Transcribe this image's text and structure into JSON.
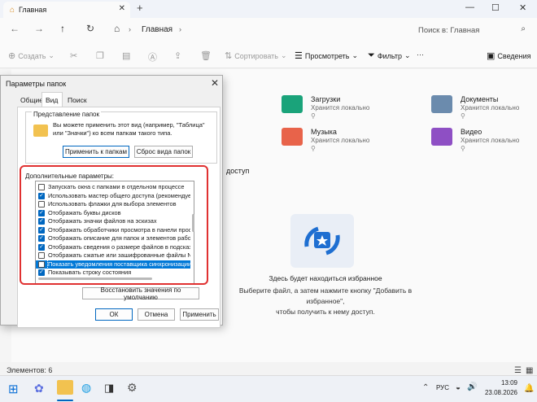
{
  "window": {
    "tab_title": "Главная",
    "new_tab": "+",
    "minimize": "—",
    "maximize": "☐",
    "close": "✕"
  },
  "nav": {
    "back": "←",
    "forward": "→",
    "up": "↑",
    "breadcrumb": "Главная",
    "search_placeholder": "Поиск в: Главная"
  },
  "toolbar": {
    "create": "Создать",
    "sort": "Сортировать",
    "view": "Просмотреть",
    "filter": "Фильтр",
    "details": "Сведения"
  },
  "quick_access": [
    {
      "name": "Загрузки",
      "sub": "Хранится локально",
      "color": "#1aa37a"
    },
    {
      "name": "Документы",
      "sub": "Хранится локально",
      "color": "#6b8bad"
    },
    {
      "name": "Музыка",
      "sub": "Хранится локально",
      "color": "#e8634a"
    },
    {
      "name": "Видео",
      "sub": "Хранится локально",
      "color": "#8e4fc4"
    }
  ],
  "partial_text": "доступ",
  "favorites": {
    "title": "Здесь будет находиться избранное",
    "desc1": "Выберите файл, а затем нажмите кнопку \"Добавить в избранное\",",
    "desc2": "чтобы получить к нему доступ."
  },
  "status": "Элементов: 6",
  "taskbar": {
    "lang": "РУС",
    "time": "13:09",
    "date": "23.08.2026"
  },
  "dialog": {
    "title": "Параметры папок",
    "tabs": [
      "Общие",
      "Вид",
      "Поиск"
    ],
    "group_title": "Представление папок",
    "group_text": "Вы можете применить этот вид (например, \"Таблица\" или \"Значки\") ко всем папкам такого типа.",
    "apply_to_folders": "Применить к папкам",
    "reset_folders": "Сброс вида папок",
    "advanced_label": "Дополнительные параметры:",
    "options": [
      {
        "label": "Запускать окна с папками в отдельном процессе",
        "checked": false,
        "selected": false
      },
      {
        "label": "Использовать мастер общего доступа (рекомендует",
        "checked": true,
        "selected": false
      },
      {
        "label": "Использовать флажки для выбора элементов",
        "checked": false,
        "selected": false
      },
      {
        "label": "Отображать буквы дисков",
        "checked": true,
        "selected": false
      },
      {
        "label": "Отображать значки файлов на эскизах",
        "checked": true,
        "selected": false
      },
      {
        "label": "Отображать обработчики просмотра в панели просм",
        "checked": true,
        "selected": false
      },
      {
        "label": "Отображать описание для папок и элементов рабоч",
        "checked": true,
        "selected": false
      },
      {
        "label": "Отображать сведения о размере файлов в подсказк",
        "checked": true,
        "selected": false
      },
      {
        "label": "Отображать сжатые или зашифрованные файлы NTI",
        "checked": false,
        "selected": false
      },
      {
        "label": "Показать уведомления поставщика синхронизации",
        "checked": false,
        "selected": true
      },
      {
        "label": "Показывать строку состояния",
        "checked": true,
        "selected": false
      }
    ],
    "restore_defaults": "Восстановить значения по умолчанию",
    "ok": "ОК",
    "cancel": "Отмена",
    "apply": "Применить"
  }
}
